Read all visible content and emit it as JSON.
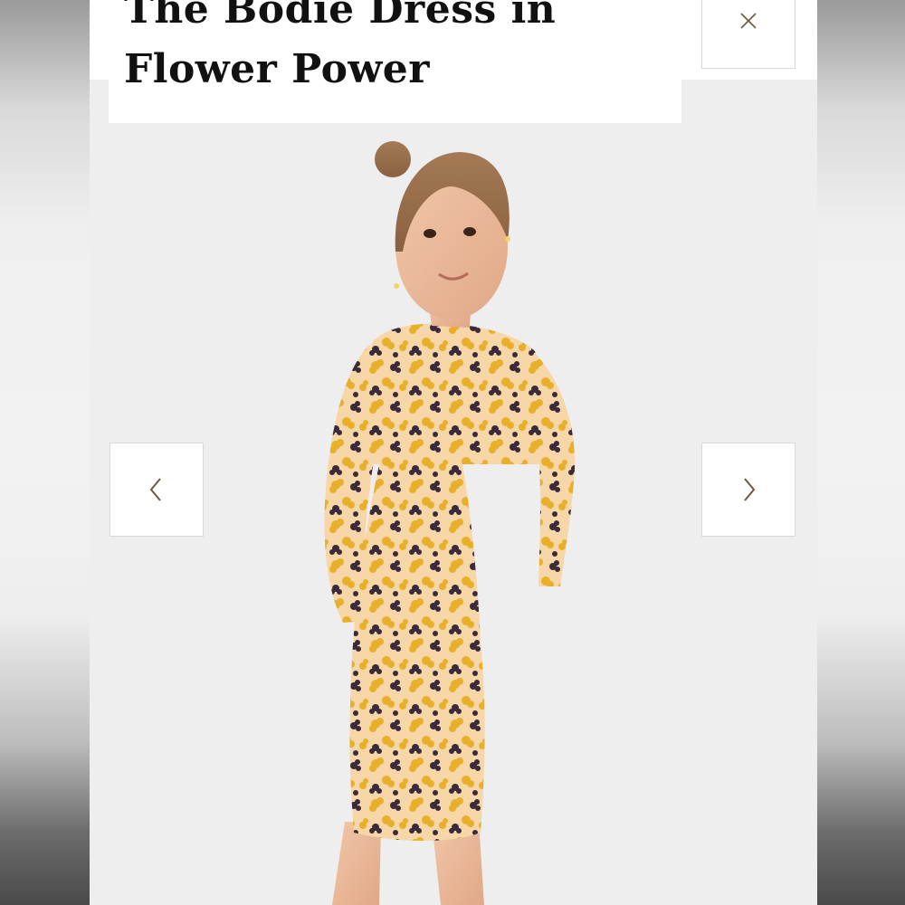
{
  "product": {
    "title": "The Bodie Dress in Flower Power"
  },
  "lightbox": {
    "close_icon": "close-icon",
    "prev_icon": "chevron-left-icon",
    "next_icon": "chevron-right-icon"
  },
  "colors": {
    "icon": "#6b5a3f",
    "panel": "#ffffff",
    "backdrop": "#eeeeef",
    "dress_base": "#f7d6a8",
    "flower_yellow": "#e8b02a",
    "flower_dark": "#3a2a3a"
  }
}
